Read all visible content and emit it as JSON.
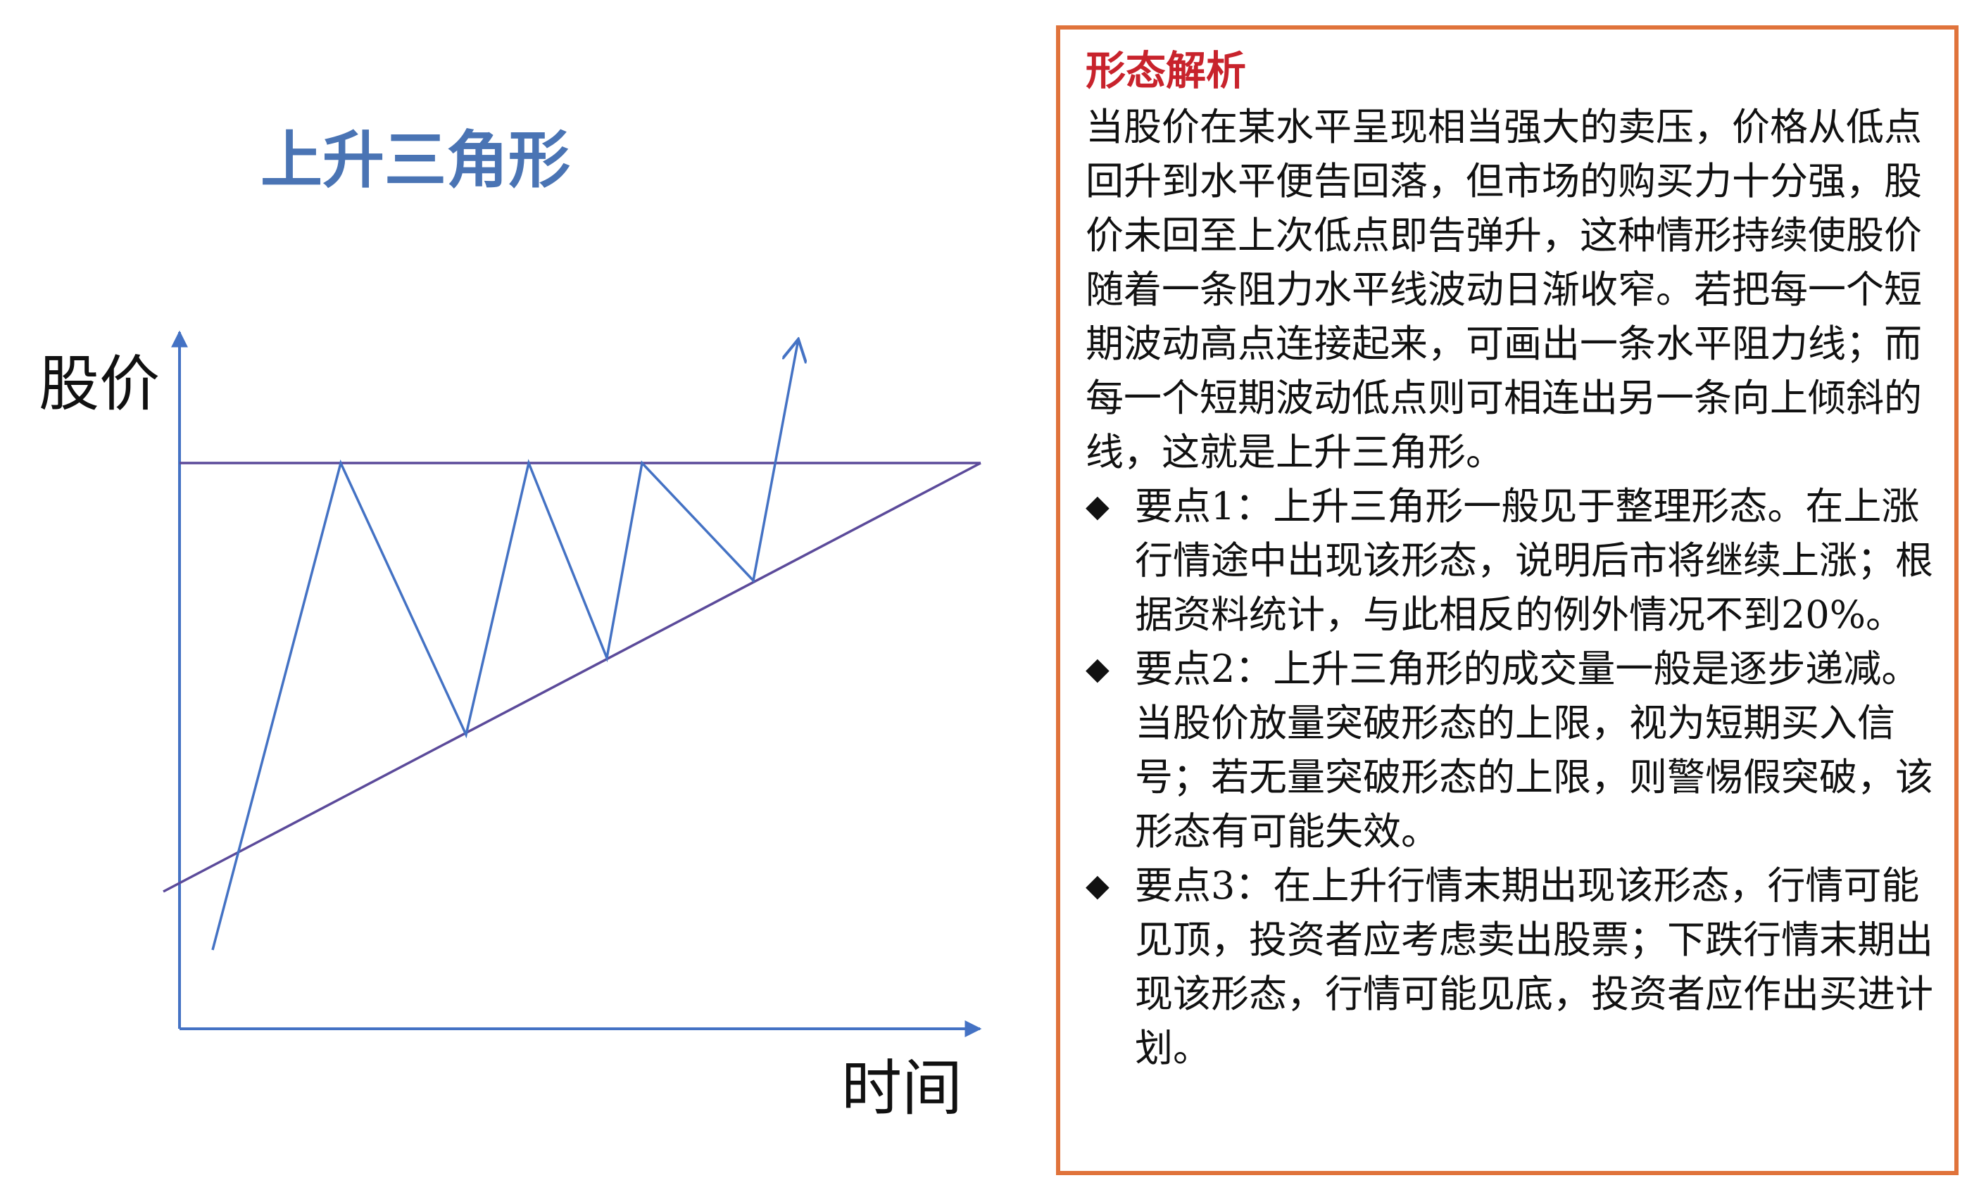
{
  "diagram": {
    "title": "上升三角形",
    "y_axis_label": "股价",
    "x_axis_label": "时间",
    "colors": {
      "title": "#4a74b4",
      "axes": "#4472c4",
      "price_line": "#4472c4",
      "trend_lines": "#5b4a9a"
    }
  },
  "panel": {
    "title": "形态解析",
    "intro": "当股价在某水平呈现相当强大的卖压，价格从低点回升到水平便告回落，但市场的购买力十分强，股价未回至上次低点即告弹升，这种情形持续使股价随着一条阻力水平线波动日渐收窄。若把每一个短期波动高点连接起来，可画出一条水平阻力线；而每一个短期波动低点则可相连出另一条向上倾斜的线，这就是上升三角形。",
    "bullet": "◆",
    "points": [
      "要点1：上升三角形一般见于整理形态。在上涨行情途中出现该形态，说明后市将继续上涨；根据资料统计，与此相反的例外情况不到20%。",
      "要点2：上升三角形的成交量一般是逐步递减。当股价放量突破形态的上限，视为短期买入信号；若无量突破形态的上限，则警惕假突破，该形态有可能失效。",
      "要点3：在上升行情末期出现该形态，行情可能见顶，投资者应考虑卖出股票；下跌行情末期出现该形态，行情可能见底，投资者应作出买进计划。"
    ],
    "colors": {
      "border": "#e0733b",
      "title": "#c8232c",
      "text": "#111111"
    }
  }
}
